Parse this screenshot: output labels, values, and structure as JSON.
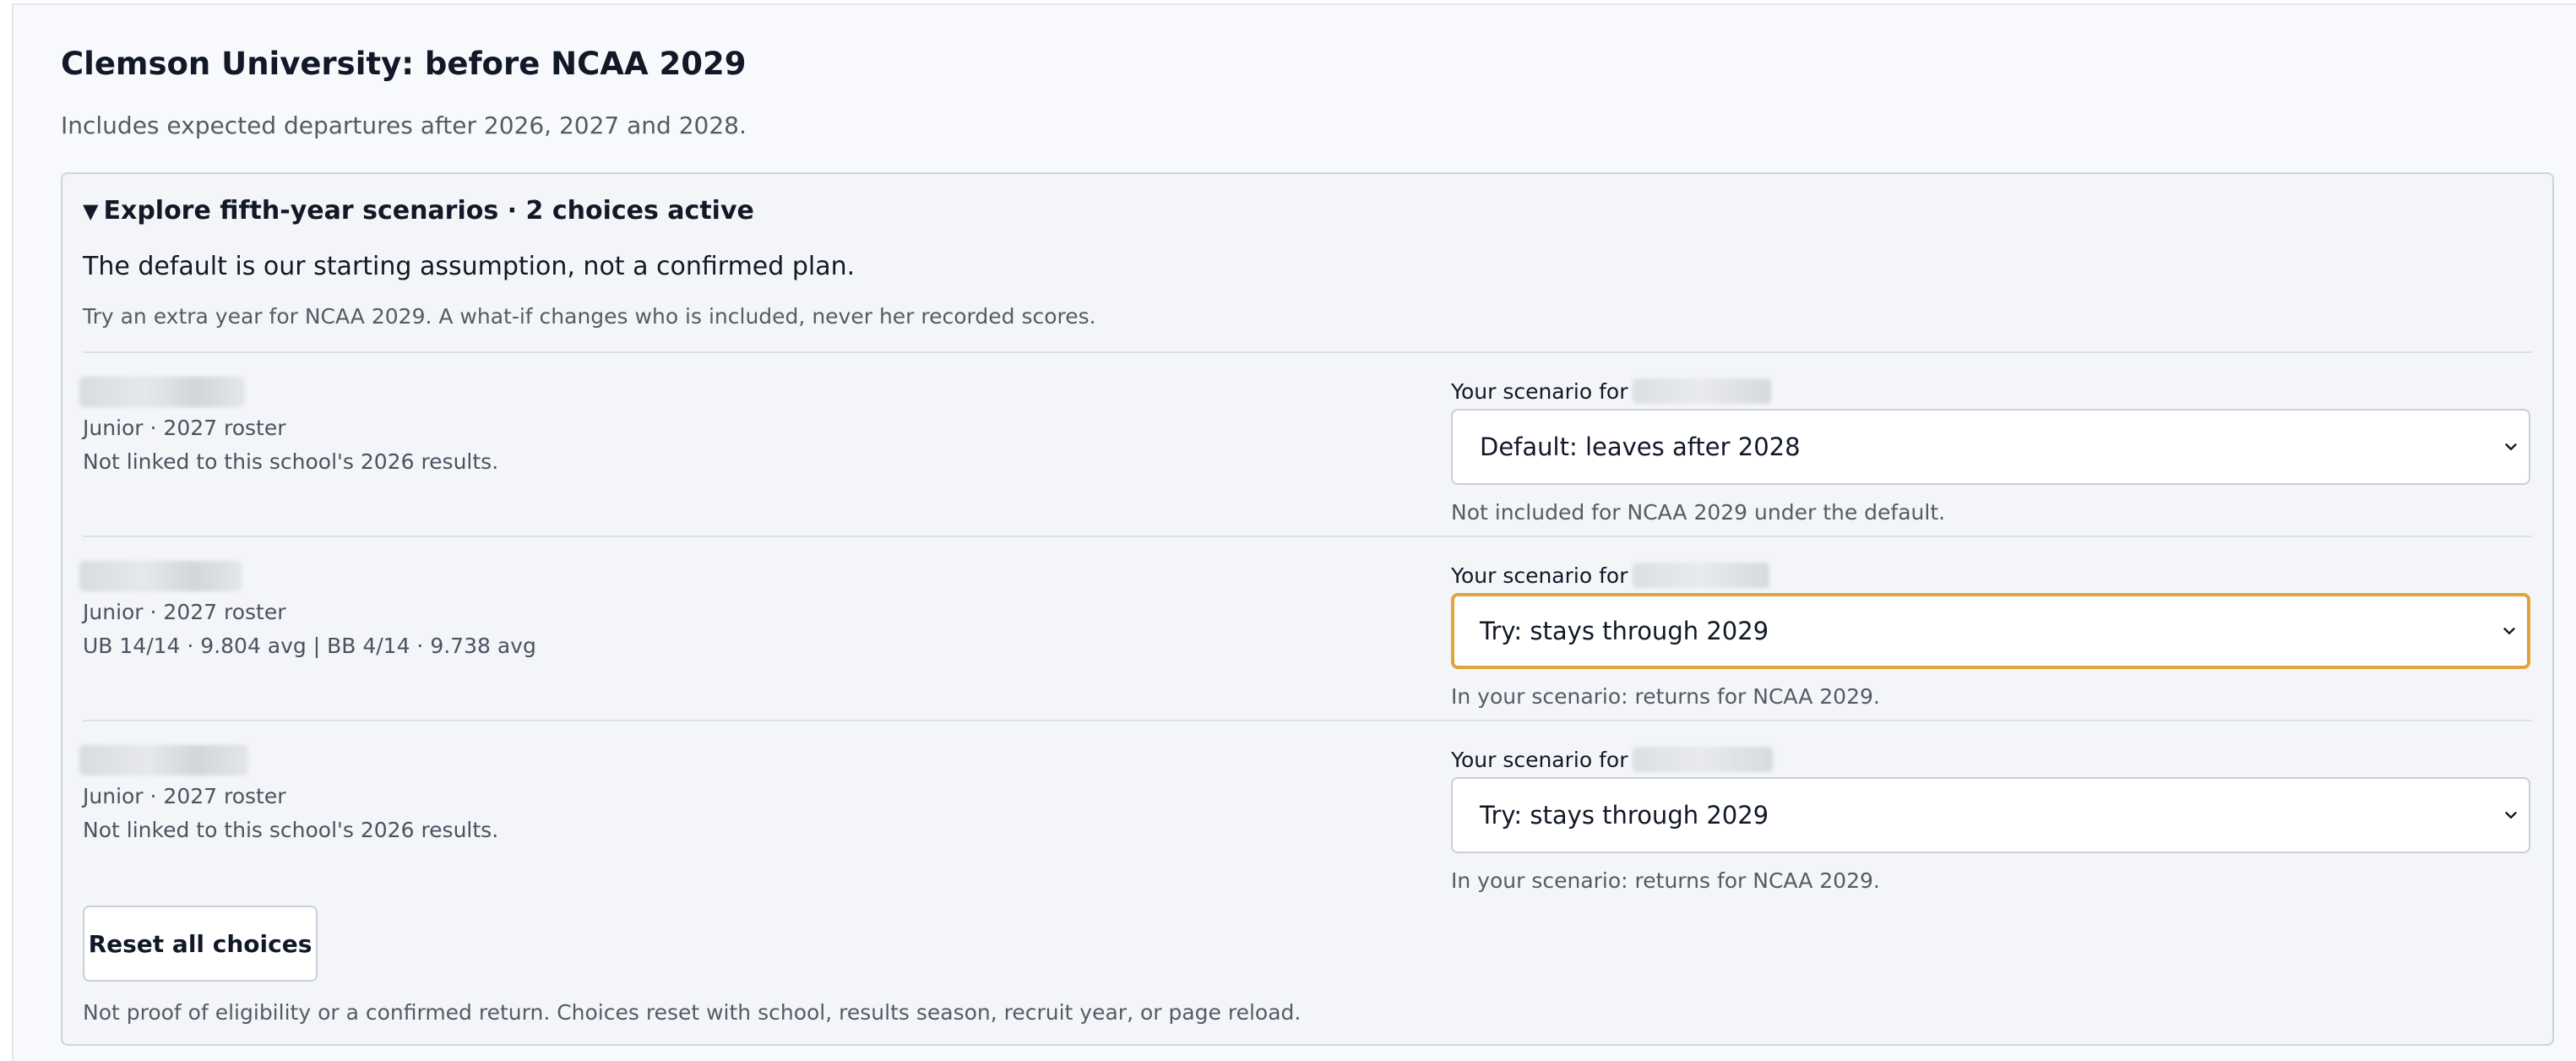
{
  "header": {
    "title": "Clemson University: before NCAA 2029",
    "subtitle": "Includes expected departures after 2026, 2027 and 2028."
  },
  "scenarios": {
    "summary": "Explore fifth-year scenarios · 2 choices active",
    "lead": "The default is our starting assumption, not a confirmed plan.",
    "hint": "Try an extra year for NCAA 2029. A what-if changes who is included, never her recorded scores.",
    "athletes": [
      {
        "class_line": "Junior · 2027 roster",
        "results_line": "Not linked to this school's 2026 results.",
        "scenario_label": "Your scenario for",
        "selected": "Default: leaves after 2028",
        "note": "Not included for NCAA 2029 under the default."
      },
      {
        "class_line": "Junior · 2027 roster",
        "results_line": "UB 14/14 · 9.804 avg | BB 4/14 · 9.738 avg",
        "scenario_label": "Your scenario for",
        "selected": "Try: stays through 2029",
        "note": "In your scenario: returns for NCAA 2029."
      },
      {
        "class_line": "Junior · 2027 roster",
        "results_line": "Not linked to this school's 2026 results.",
        "scenario_label": "Your scenario for",
        "selected": "Try: stays through 2029",
        "note": "In your scenario: returns for NCAA 2029."
      }
    ],
    "reset_label": "Reset all choices",
    "footer": "Not proof of eligibility or a confirmed return. Choices reset with school, results season, recruit year, or page reload."
  },
  "colors": {
    "focus_ring": "#e0a43a",
    "panel_bg": "#f3f5f8",
    "border": "#c9ced8"
  },
  "icons": {
    "summary_marker": "triangle-down-icon",
    "select_arrow": "chevron-down-icon"
  }
}
